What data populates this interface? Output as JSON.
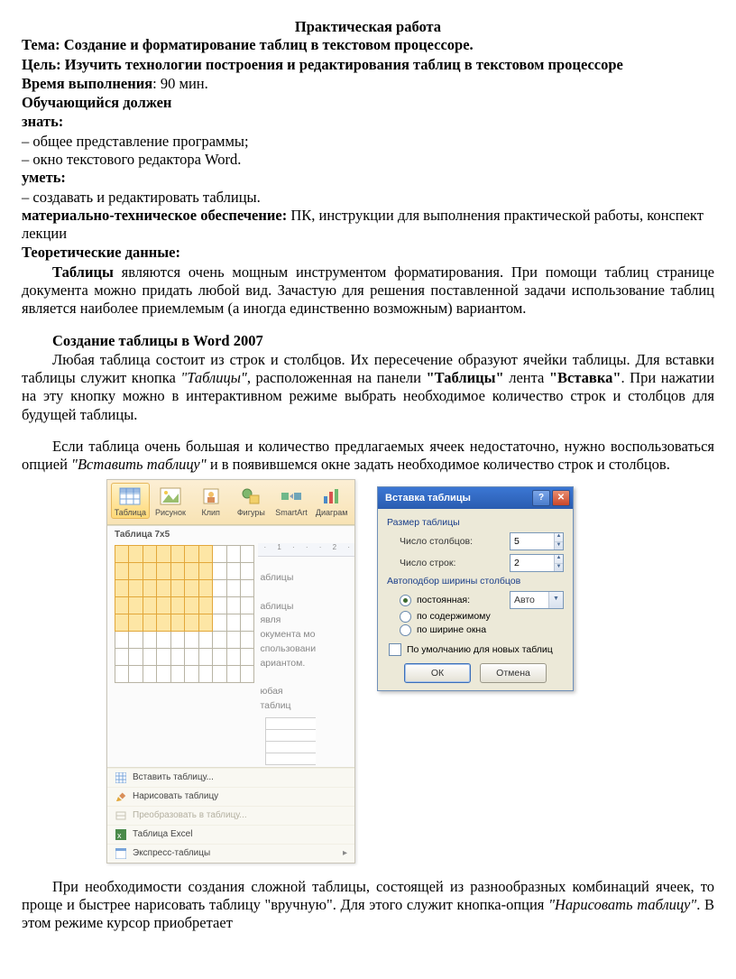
{
  "title": "Практическая работа",
  "topic_label": "Тема:",
  "topic_text": " Создание и форматирование таблиц в текстовом процессоре.",
  "goal_label": "Цель:",
  "goal_text": " Изучить технологии построения и редактирования таблиц в текстовом процессоре",
  "time_label": "Время выполнения",
  "time_text": ": 90 мин.",
  "learner_label": "Обучающийся должен",
  "know_label": "знать:",
  "know_items": [
    "общее представление программы;",
    "окно текстового редактора Word."
  ],
  "can_label": "уметь:",
  "can_items": [
    "создавать и редактировать таблицы."
  ],
  "mat_label": "материально-техническое обеспечение:",
  "mat_text": " ПК, инструкции для выполнения практической работы, конспект лекции",
  "theory_label": "Теоретические данные:",
  "p1_lead": "Таблицы",
  "p1_rest": " являются очень мощным инструментом форматирования. При помощи таблиц странице документа можно придать любой вид. Зачастую для решения поставленной задачи использование таблиц является наиболее приемлемым (а иногда единственно возможным) вариантом.",
  "h2": "Создание таблицы в Word 2007",
  "p2_a": "Любая таблица состоит из строк и столбцов. Их пересечение образуют ячейки таблицы. Для вставки таблицы служит кнопка ",
  "p2_b": "\"Таблицы\"",
  "p2_c": ", расположенная на  панели ",
  "p2_d": "\"Таблицы\"",
  "p2_e": " лента ",
  "p2_f": "\"Вставка\"",
  "p2_g": ". При нажатии на эту кнопку можно в интерактивном режиме выбрать необходимое количество строк и столбцов для будущей таблицы.",
  "p3_a": "Если таблица очень большая и количество предлагаемых ячеек недостаточно, нужно воспользоваться опцией ",
  "p3_b": "\"Вставить таблицу\"",
  "p3_c": " и в появившемся окне задать необходимое количество строк и столбцов.",
  "p4_a": "При необходимости создания сложной таблицы, состоящей из разнообразных комбинаций ячеек, то проще и быстрее нарисовать таблицу \"вручную\". Для этого служит кнопка-опция ",
  "p4_b": "\"Нарисовать таблицу\"",
  "p4_c": ". В этом режиме курсор приобретает",
  "fig1": {
    "ribbon": [
      "Таблица",
      "Рисунок",
      "Клип",
      "Фигуры",
      "SmartArt",
      "Диаграм"
    ],
    "dd_title": "Таблица 7x5",
    "ruler": "· 1 · · · 2 ·",
    "side": [
      "аблицы",
      "аблицы явля",
      "окумента мо",
      "спользовани",
      "ариантом."
    ],
    "side_last": "юбая таблиц",
    "menu": [
      "Вставить таблицу...",
      "Нарисовать таблицу",
      "Преобразовать в таблицу...",
      "Таблица Excel",
      "Экспресс-таблицы"
    ]
  },
  "fig2": {
    "title": "Вставка таблицы",
    "grp1": "Размер таблицы",
    "cols_lbl": "Число столбцов:",
    "cols_val": "5",
    "rows_lbl": "Число строк:",
    "rows_val": "2",
    "grp2": "Автоподбор ширины столбцов",
    "r1": "постоянная:",
    "r1_val": "Авто",
    "r2": "по содержимому",
    "r3": "по ширине окна",
    "chk": "По умолчанию для новых таблиц",
    "ok": "ОК",
    "cancel": "Отмена"
  }
}
